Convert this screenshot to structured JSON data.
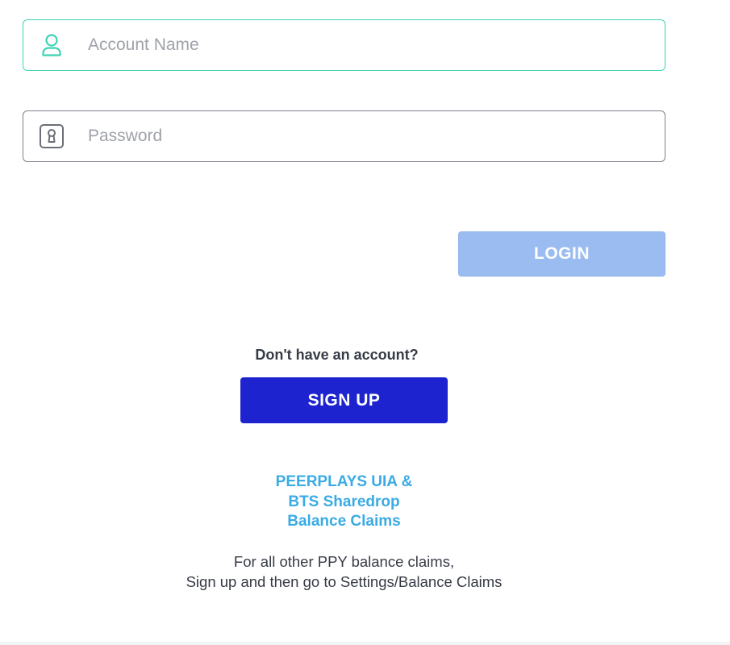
{
  "login_form": {
    "account_name": {
      "placeholder": "Account Name",
      "value": "",
      "icon": "user-icon"
    },
    "password": {
      "placeholder": "Password",
      "value": "",
      "icon": "keyhole-lock-icon"
    },
    "login_label": "LOGIN"
  },
  "signup": {
    "prompt": "Don't have an account?",
    "button_label": "SIGN UP"
  },
  "claims": {
    "link_lines": [
      "PEERPLAYS UIA &",
      "BTS Sharedrop",
      "Balance Claims"
    ],
    "info_lines": [
      "For all other PPY balance claims,",
      "Sign up and then go to Settings/Balance Claims"
    ]
  },
  "colors": {
    "accent_teal": "#3fd2b4",
    "login_disabled": "#9bbcf0",
    "signup_blue": "#1c23cf",
    "link_blue": "#3aabe4",
    "text_dark": "#363b45"
  }
}
